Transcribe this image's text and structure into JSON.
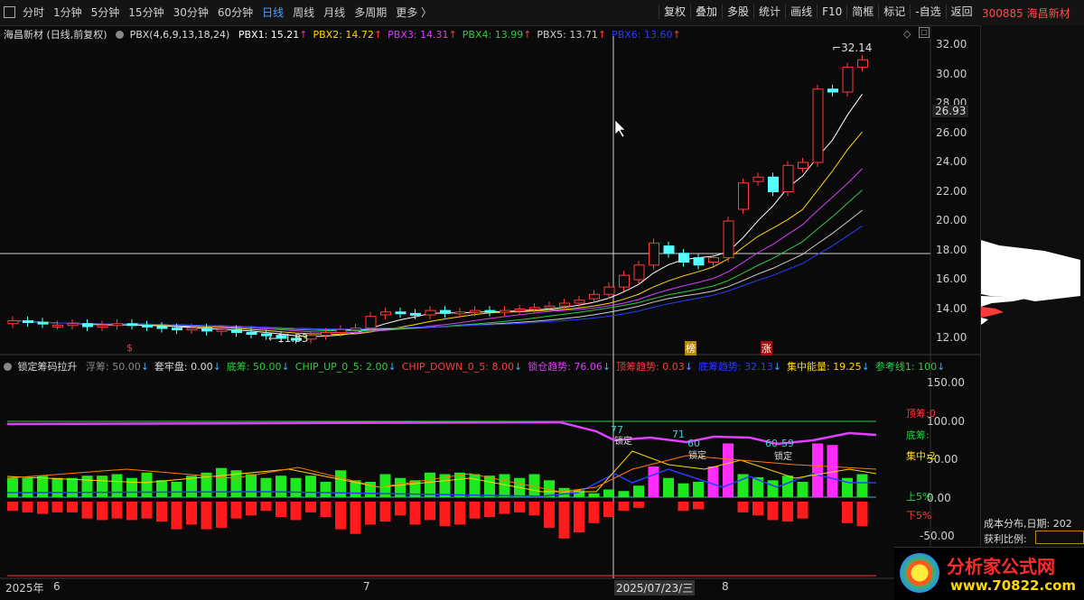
{
  "toolbar": {
    "periods": [
      "分时",
      "1分钟",
      "5分钟",
      "15分钟",
      "30分钟",
      "60分钟",
      "日线",
      "周线",
      "月线",
      "多周期",
      "更多 〉"
    ],
    "active_period": "日线",
    "buttons": [
      "复权",
      "叠加",
      "多股",
      "统计",
      "画线",
      "F10",
      "简框",
      "标记",
      "-自选",
      "返回"
    ],
    "stock_code_name": "300885 海昌新材"
  },
  "main_chart": {
    "title_name": "海昌新材 (日线,前复权)",
    "indicator_name": "PBX(4,6,9,13,18,24)",
    "pbx_values": [
      {
        "label": "PBX1: 15.21",
        "color": "#ffffff"
      },
      {
        "label": "PBX2: 14.72",
        "color": "#ffd700"
      },
      {
        "label": "PBX3: 14.31",
        "color": "#d63cff"
      },
      {
        "label": "PBX4: 13.99",
        "color": "#2ecc40"
      },
      {
        "label": "PBX5: 13.71",
        "color": "#cfcfcf"
      },
      {
        "label": "PBX6: 13.60",
        "color": "#2a3cff"
      }
    ],
    "y_ticks": [
      "32.00",
      "30.00",
      "28.00",
      "26.00",
      "24.00",
      "22.00",
      "20.00",
      "18.00",
      "16.00",
      "14.00",
      "12.00"
    ],
    "current_price": "26.93",
    "high_label": "32.14",
    "low_label": "11.83",
    "crosshair_price": "17.9",
    "markers": [
      "榜",
      "涨"
    ]
  },
  "sub_chart": {
    "title": "锁定筹码拉升",
    "values": [
      {
        "label": "浮筹: 50.00",
        "color": "#888888"
      },
      {
        "label": "套牢盘: 0.00",
        "color": "#dddddd"
      },
      {
        "label": "底筹: 50.00",
        "color": "#2ecc40"
      },
      {
        "label": "CHIP_UP_0_5: 2.00",
        "color": "#2ecc40"
      },
      {
        "label": "CHIP_DOWN_0_5: 8.00",
        "color": "#ff3b3b"
      },
      {
        "label": "锁仓趋势: 76.06",
        "color": "#e040ff"
      },
      {
        "label": "顶筹趋势: 0.03",
        "color": "#ff3b3b"
      },
      {
        "label": "底筹趋势: 32.13",
        "color": "#2a3cff"
      },
      {
        "label": "集中能量: 19.25",
        "color": "#ffd700"
      },
      {
        "label": "参考线1: 100",
        "color": "#2ecc40"
      }
    ],
    "y_ticks": [
      "150.00",
      "100.00",
      "50.00",
      "0.00",
      "-50.00"
    ],
    "right_labels": [
      {
        "text": "顶筹:0",
        "color": "#ff3b3b"
      },
      {
        "text": "底筹:",
        "color": "#2ecc40"
      },
      {
        "text": "集中:2",
        "color": "#ffd700"
      },
      {
        "text": "上5%",
        "color": "#2ecc40"
      },
      {
        "text": "下5%",
        "color": "#ff3b3b"
      }
    ],
    "peak_labels": [
      "77",
      "71",
      "60",
      "60",
      "59"
    ],
    "lock_labels": [
      "锁定",
      "锁定",
      "锁定"
    ]
  },
  "x_axis": {
    "year": "2025年",
    "months": [
      "6",
      "7",
      "8"
    ],
    "crosshair_date": "2025/07/23/三"
  },
  "right_panel": {
    "cost_label": "成本分布,日期: 202",
    "profit_label": "获利比例:"
  },
  "logo": {
    "name": "分析家公式网",
    "url": "www.70822.com"
  }
}
